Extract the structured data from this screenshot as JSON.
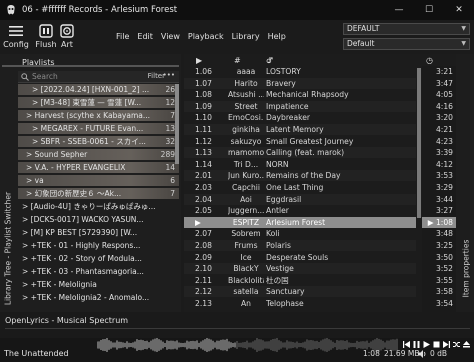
{
  "window": {
    "title": "06 - #ffffff Records - Arlesium Forest",
    "minimize": "—",
    "maximize": "☐",
    "close": "✕"
  },
  "toolbar": {
    "config_label": "Config",
    "flush_label": "Flush",
    "art_label": "Art"
  },
  "menu": {
    "items": [
      "File",
      "Edit",
      "View",
      "Playback",
      "Library",
      "Help"
    ]
  },
  "combos": {
    "layout_top": "DEFAULT",
    "layout_bottom": "Default"
  },
  "playlists_panel": {
    "title": "Playlists",
    "search_placeholder": "Search",
    "filter_label": "Filter",
    "filter_more": "•••",
    "side_label": "Library Tree - Playlist Switcher",
    "rows": [
      {
        "label": "> [2022.04.24] [HXN-001_2] ...",
        "count": "26",
        "indent": 10
      },
      {
        "label": "> [M3-48] 東雪蓮 — 雪蓮 [W...",
        "count": "12",
        "indent": 10
      },
      {
        "label": "> Harvest (scythe x Kabayama...",
        "count": "7",
        "indent": 4
      },
      {
        "label": "> MEGAREX - FUTURE Evan...",
        "count": "13",
        "indent": 10
      },
      {
        "label": "> SBFR - SSEB-0061 - スカイ...",
        "count": "32",
        "indent": 10
      },
      {
        "label": "> Sound Sepher",
        "count": "289",
        "indent": 4
      },
      {
        "label": "> V.A. - HYPER EVANGELIX",
        "count": "14",
        "indent": 4
      },
      {
        "label": "> va",
        "count": "6",
        "indent": 4
      },
      {
        "label": "> 幻象団の新歴史６ 〜Ak...",
        "count": "7",
        "indent": 4
      },
      {
        "label": "> [Audio-4U] きゃりーぱみゅぱみゅ...",
        "count": "",
        "indent": 0
      },
      {
        "label": "> [DCKS-0017] WACKO YASUN...",
        "count": "",
        "indent": 0
      },
      {
        "label": "> [M] KP BEST [5729390] [W...",
        "count": "",
        "indent": 0
      },
      {
        "label": "> +TEK - 01 - Highly Respons...",
        "count": "",
        "indent": 0
      },
      {
        "label": "> +TEK - 02 - Story of Modula...",
        "count": "",
        "indent": 0
      },
      {
        "label": "> +TEK - 03 - Phantasmagoria...",
        "count": "",
        "indent": 0
      },
      {
        "label": "> +TEK - Melolignia",
        "count": "",
        "indent": 0
      },
      {
        "label": "> +TEK - Melolignia2 - Anomalo...",
        "count": "",
        "indent": 0
      }
    ]
  },
  "playlist": {
    "header": {
      "play": "▶",
      "track": "#",
      "artist": "♂",
      "title": "♪",
      "time": "◷"
    },
    "rows": [
      {
        "num": "1.06",
        "artist": "aaaa",
        "title": "LOSTORY",
        "time": "3:21"
      },
      {
        "num": "1.07",
        "artist": "Harito",
        "title": "Bravery",
        "time": "3:47"
      },
      {
        "num": "1.08",
        "artist": "Atsushi ...",
        "title": "Mechanical Rhapsody",
        "time": "4:05"
      },
      {
        "num": "1.09",
        "artist": "Street",
        "title": "Impatience",
        "time": "4:16"
      },
      {
        "num": "1.10",
        "artist": "EmoCosi...",
        "title": "Daybreaker",
        "time": "3:20"
      },
      {
        "num": "1.11",
        "artist": "ginkiha",
        "title": "Latent Memory",
        "time": "4:21"
      },
      {
        "num": "1.12",
        "artist": "sakuzyo",
        "title": "Small Greatest Journey",
        "time": "4:23"
      },
      {
        "num": "1.13",
        "artist": "mamomo",
        "title": "Calling (feat. marok)",
        "time": "3:39"
      },
      {
        "num": "1.14",
        "artist": "Tri D...",
        "title": "NORN",
        "time": "4:12"
      },
      {
        "num": "2.01",
        "artist": "Jun Kuro...",
        "title": "Remains of the Day",
        "time": "3:53"
      },
      {
        "num": "2.03",
        "artist": "Capchii",
        "title": "One Last Thing",
        "time": "3:29"
      },
      {
        "num": "2.04",
        "artist": "Aoi",
        "title": "Eggdrasil",
        "time": "3:44"
      },
      {
        "num": "2.05",
        "artist": "Juggern...",
        "title": "Antler",
        "time": "3:27"
      },
      {
        "num": "▶",
        "artist": "ESPITZ",
        "title": "Arlesium Forest",
        "time": "▶ 1:08",
        "active": true
      },
      {
        "num": "2.07",
        "artist": "Sobrem",
        "title": "Koli",
        "time": "3:48"
      },
      {
        "num": "2.08",
        "artist": "Frums",
        "title": "Polaris",
        "time": "3:25"
      },
      {
        "num": "2.09",
        "artist": "Ice",
        "title": "Desperate Souls",
        "time": "3:50"
      },
      {
        "num": "2.10",
        "artist": "BlackY",
        "title": "Vestige",
        "time": "3:52"
      },
      {
        "num": "2.11",
        "artist": "Blacklolita",
        "title": "杜の国",
        "time": "3:55"
      },
      {
        "num": "2.12",
        "artist": "satella",
        "title": "Sanctuary",
        "time": "3:58"
      },
      {
        "num": "2.13",
        "artist": "An",
        "title": "Telophase",
        "time": "3:54"
      }
    ]
  },
  "right_panel": {
    "label": "Item properties"
  },
  "spectrum": {
    "title": "OpenLyrics - Musical Spectrum"
  },
  "status": {
    "track_name": "The Unattended",
    "elapsed": "1:08",
    "memory": "21.69 MB",
    "volume": "0 dB"
  }
}
